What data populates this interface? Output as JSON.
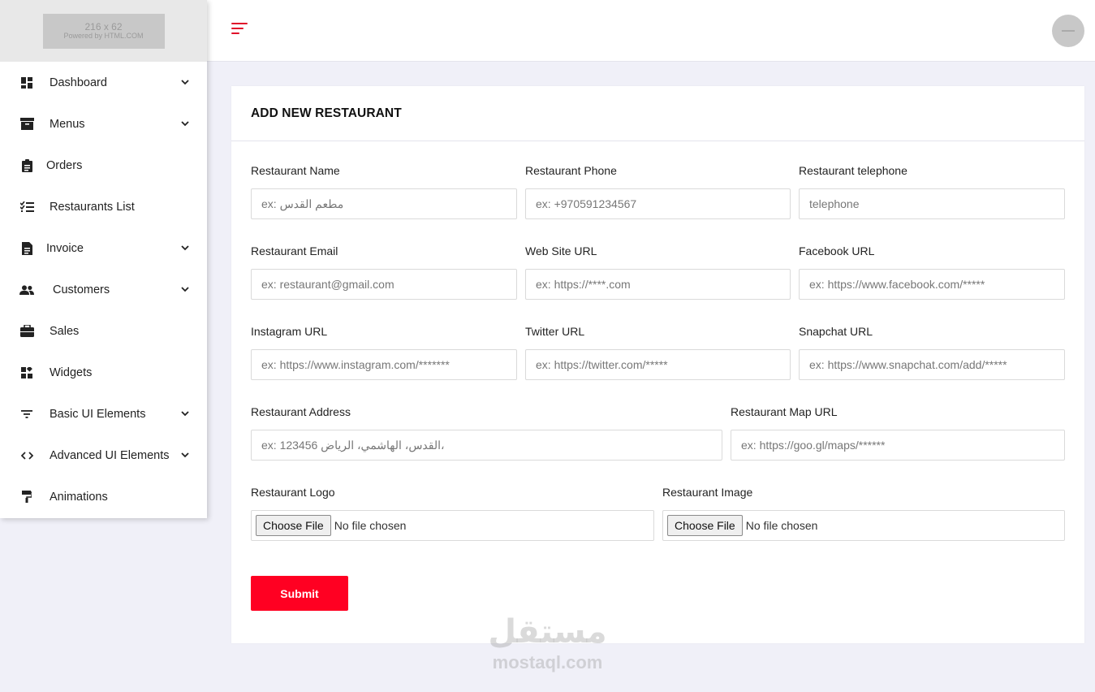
{
  "logo": {
    "dims": "216 x 62",
    "powered": "Powered by HTML.COM"
  },
  "sidebar": {
    "items": [
      {
        "label": "Dashboard",
        "icon": "dashboard-icon",
        "chevron": true
      },
      {
        "label": "Menus",
        "icon": "archive-icon",
        "chevron": true
      },
      {
        "label": "Orders",
        "icon": "clipboard-icon",
        "chevron": false
      },
      {
        "label": "Restaurants List",
        "icon": "checklist-icon",
        "chevron": false
      },
      {
        "label": "Invoice",
        "icon": "document-icon",
        "chevron": true
      },
      {
        "label": "Customers",
        "icon": "users-icon",
        "chevron": true
      },
      {
        "label": "Sales",
        "icon": "briefcase-icon",
        "chevron": false
      },
      {
        "label": "Widgets",
        "icon": "widgets-icon",
        "chevron": false
      },
      {
        "label": "Basic UI Elements",
        "icon": "filter-icon",
        "chevron": true
      },
      {
        "label": "Advanced UI Elements",
        "icon": "code-icon",
        "chevron": true
      },
      {
        "label": "Animations",
        "icon": "paint-roller-icon",
        "chevron": false
      }
    ]
  },
  "form": {
    "title": "ADD NEW RESTAURANT",
    "name": {
      "label": "Restaurant Name",
      "placeholder": "ex: مطعم القدس"
    },
    "phone": {
      "label": "Restaurant Phone",
      "placeholder": "ex: +970591234567"
    },
    "telephone": {
      "label": "Restaurant telephone",
      "placeholder": "telephone"
    },
    "email": {
      "label": "Restaurant Email",
      "placeholder": "ex: restaurant@gmail.com"
    },
    "website": {
      "label": "Web Site URL",
      "placeholder": "ex: https://****.com"
    },
    "facebook": {
      "label": "Facebook URL",
      "placeholder": "ex: https://www.facebook.com/*****"
    },
    "instagram": {
      "label": "Instagram URL",
      "placeholder": "ex: https://www.instagram.com/*******"
    },
    "twitter": {
      "label": "Twitter URL",
      "placeholder": "ex: https://twitter.com/*****"
    },
    "snapchat": {
      "label": "Snapchat URL",
      "placeholder": "ex: https://www.snapchat.com/add/*****"
    },
    "address": {
      "label": "Restaurant Address",
      "placeholder": "ex: 123456 القدس، الهاشمي، الرياض،"
    },
    "map": {
      "label": "Restaurant Map URL",
      "placeholder": "ex: https://goo.gl/maps/******"
    },
    "logo": {
      "label": "Restaurant Logo",
      "button": "Choose File",
      "status": "No file chosen"
    },
    "image": {
      "label": "Restaurant Image",
      "button": "Choose File",
      "status": "No file chosen"
    },
    "submit": "Submit"
  },
  "watermark": {
    "arabic": "مستقل",
    "latin": "mostaql.com"
  }
}
